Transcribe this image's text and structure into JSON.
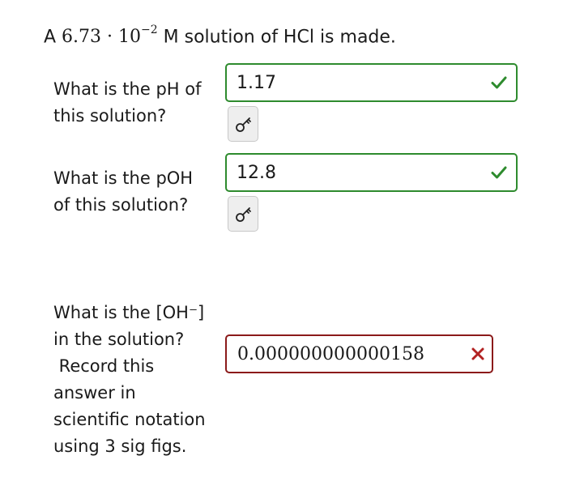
{
  "problem": {
    "prefix": "A ",
    "mantissa": "6.73 · 10",
    "exponent": "−2",
    "suffix": " M solution of HCl is made."
  },
  "questions": [
    {
      "lines": [
        "What is the pH of",
        "this solution?"
      ],
      "answer": "1.17",
      "status": "correct"
    },
    {
      "lines": [
        "What is the pOH",
        "of this solution?"
      ],
      "answer": "12.8",
      "status": "correct"
    },
    {
      "lines": [
        "What is the [OH⁻]",
        "in the solution?",
        " Record this",
        "answer in",
        "scientific notation",
        "using 3 sig figs."
      ],
      "answer": "0.000000000000158",
      "status": "incorrect"
    }
  ],
  "icons": {
    "correct": "checkmark-icon",
    "incorrect": "x-mark-icon",
    "hint": "key-icon"
  },
  "colors": {
    "correct": "#2e8b2e",
    "incorrect": "#b22222"
  }
}
